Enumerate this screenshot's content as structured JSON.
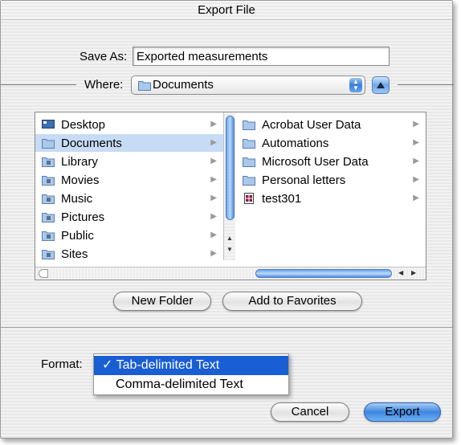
{
  "dialog": {
    "title": "Export File"
  },
  "save_as": {
    "label": "Save As:",
    "value": "Exported measurements"
  },
  "where": {
    "label": "Where:",
    "value": "Documents"
  },
  "left_column": [
    {
      "label": "Desktop",
      "icon": "desktop-icon"
    },
    {
      "label": "Documents",
      "icon": "folder-icon",
      "selected": true
    },
    {
      "label": "Library",
      "icon": "library-folder-icon"
    },
    {
      "label": "Movies",
      "icon": "movies-folder-icon"
    },
    {
      "label": "Music",
      "icon": "music-folder-icon"
    },
    {
      "label": "Pictures",
      "icon": "pictures-folder-icon"
    },
    {
      "label": "Public",
      "icon": "public-folder-icon"
    },
    {
      "label": "Sites",
      "icon": "sites-folder-icon"
    }
  ],
  "right_column": [
    {
      "label": "Acrobat User Data",
      "icon": "folder-icon"
    },
    {
      "label": "Automations",
      "icon": "folder-icon"
    },
    {
      "label": "Microsoft User Data",
      "icon": "folder-icon"
    },
    {
      "label": "Personal letters",
      "icon": "folder-icon"
    },
    {
      "label": "test301",
      "icon": "document-icon"
    }
  ],
  "buttons": {
    "new_folder": "New Folder",
    "add_to_favorites": "Add to Favorites",
    "cancel": "Cancel",
    "export": "Export"
  },
  "format": {
    "label": "Format:",
    "options": [
      {
        "label": "✓ Tab-delimited Text",
        "selected": true
      },
      {
        "label": "Comma-delimited Text",
        "selected": false
      }
    ]
  },
  "colors": {
    "selection": "#c7dbf4",
    "menu_highlight": "#1a5ed4",
    "aqua_blue": "#3e86e0"
  }
}
